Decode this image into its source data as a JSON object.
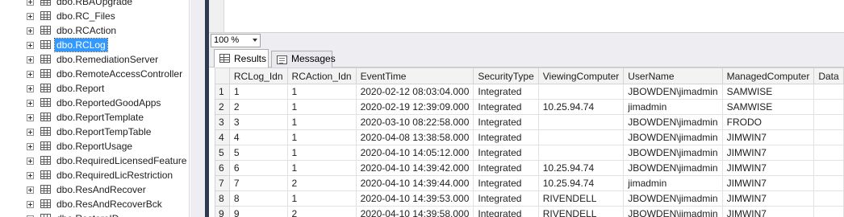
{
  "object_explorer": {
    "items": [
      {
        "label": "dbo.RBAUpgrade"
      },
      {
        "label": "dbo.RC_Files"
      },
      {
        "label": "dbo.RCAction"
      },
      {
        "label": "dbo.RCLog",
        "selected": true
      },
      {
        "label": "dbo.RemediationServer"
      },
      {
        "label": "dbo.RemoteAccessController"
      },
      {
        "label": "dbo.Report"
      },
      {
        "label": "dbo.ReportedGoodApps"
      },
      {
        "label": "dbo.ReportTemplate"
      },
      {
        "label": "dbo.ReportTempTable"
      },
      {
        "label": "dbo.ReportUsage"
      },
      {
        "label": "dbo.RequiredLicensedFeature"
      },
      {
        "label": "dbo.RequiredLicRestriction"
      },
      {
        "label": "dbo.ResAndRecover"
      },
      {
        "label": "dbo.ResAndRecoverBck"
      },
      {
        "label": "dbo.RestoreID"
      }
    ]
  },
  "zoom": {
    "value": "100 %"
  },
  "tabs": {
    "results": "Results",
    "messages": "Messages"
  },
  "results": {
    "columns": [
      "RCLog_Idn",
      "RCAction_Idn",
      "EventTime",
      "SecurityType",
      "ViewingComputer",
      "UserName",
      "ManagedComputer",
      "Data"
    ],
    "rows": [
      {
        "n": "1",
        "cells": [
          "1",
          "1",
          "2020-02-12 08:03:04.000",
          "Integrated",
          "",
          "JBOWDEN\\jimadmin",
          "SAMWISE",
          ""
        ]
      },
      {
        "n": "2",
        "cells": [
          "2",
          "1",
          "2020-02-19 12:39:09.000",
          "Integrated",
          "10.25.94.74",
          "jimadmin",
          "SAMWISE",
          ""
        ]
      },
      {
        "n": "3",
        "cells": [
          "3",
          "1",
          "2020-03-10 08:22:58.000",
          "Integrated",
          "",
          "JBOWDEN\\jimadmin",
          "FRODO",
          ""
        ]
      },
      {
        "n": "4",
        "cells": [
          "4",
          "1",
          "2020-04-08 13:38:58.000",
          "Integrated",
          "",
          "JBOWDEN\\jimadmin",
          "JIMWIN7",
          ""
        ]
      },
      {
        "n": "5",
        "cells": [
          "5",
          "1",
          "2020-04-10 14:05:12.000",
          "Integrated",
          "",
          "JBOWDEN\\jimadmin",
          "JIMWIN7",
          ""
        ]
      },
      {
        "n": "6",
        "cells": [
          "6",
          "1",
          "2020-04-10 14:39:42.000",
          "Integrated",
          "10.25.94.74",
          "JBOWDEN\\jimadmin",
          "JIMWIN7",
          ""
        ]
      },
      {
        "n": "7",
        "cells": [
          "7",
          "2",
          "2020-04-10 14:39:44.000",
          "Integrated",
          "10.25.94.74",
          "jimadmin",
          "JIMWIN7",
          ""
        ]
      },
      {
        "n": "8",
        "cells": [
          "8",
          "1",
          "2020-04-10 14:39:53.000",
          "Integrated",
          "RIVENDELL",
          "JBOWDEN\\jimadmin",
          "JIMWIN7",
          ""
        ]
      },
      {
        "n": "9",
        "cells": [
          "9",
          "2",
          "2020-04-10 14:39:58.000",
          "Integrated",
          "RIVENDELL",
          "JBOWDEN\\jimadmin",
          "JIMWIN7",
          ""
        ]
      }
    ]
  },
  "colors": {
    "selection": "#3399ff",
    "divider": "#2d3a4f"
  }
}
